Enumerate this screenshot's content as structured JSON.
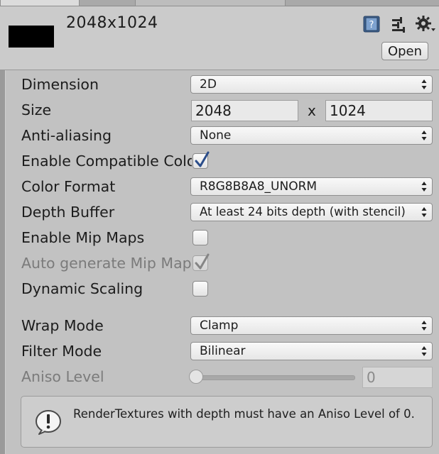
{
  "header": {
    "asset_title": "2048x1024",
    "open_button": "Open",
    "icons": [
      "help-book-icon",
      "preset-sliders-icon",
      "gear-menu-icon"
    ]
  },
  "properties": {
    "dimension": {
      "label": "Dimension",
      "value": "2D"
    },
    "size": {
      "label": "Size",
      "width": "2048",
      "separator": "x",
      "height": "1024"
    },
    "anti_aliasing": {
      "label": "Anti-aliasing",
      "value": "None"
    },
    "enable_compatible_color": {
      "label": "Enable Compatible Color Format",
      "checked": true
    },
    "color_format": {
      "label": "Color Format",
      "value": "R8G8B8A8_UNORM"
    },
    "depth_buffer": {
      "label": "Depth Buffer",
      "value": "At least 24 bits depth (with stencil)"
    },
    "enable_mip_maps": {
      "label": "Enable Mip Maps",
      "checked": false
    },
    "auto_generate_mip_maps": {
      "label": "Auto generate Mip Maps",
      "checked": true,
      "disabled": true
    },
    "dynamic_scaling": {
      "label": "Dynamic Scaling",
      "checked": false
    },
    "wrap_mode": {
      "label": "Wrap Mode",
      "value": "Clamp"
    },
    "filter_mode": {
      "label": "Filter Mode",
      "value": "Bilinear"
    },
    "aniso_level": {
      "label": "Aniso Level",
      "value": "0",
      "disabled": true
    }
  },
  "help_box": {
    "message": "RenderTextures with depth must have an Aniso Level of 0."
  },
  "colors": {
    "inspector_bg": "#c2c2c2",
    "header_bg": "#cbcbcb",
    "checkmark_blue": "#2b4d8a"
  }
}
